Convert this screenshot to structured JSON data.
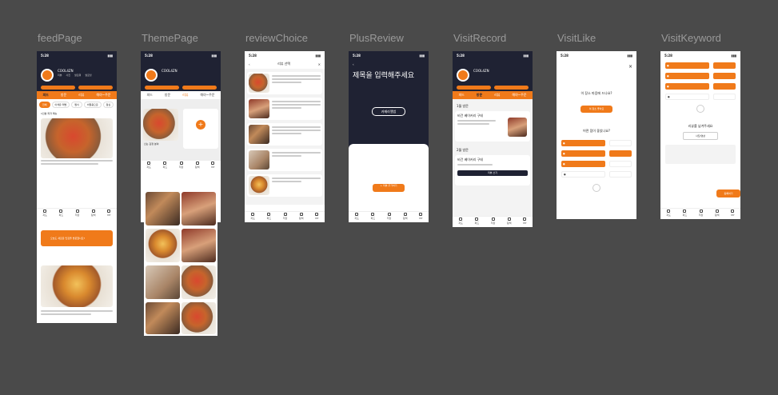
{
  "screens": [
    {
      "label": "feedPage"
    },
    {
      "label": "ThemePage"
    },
    {
      "label": "reviewChoice"
    },
    {
      "label": "PlusReview"
    },
    {
      "label": "VisitRecord"
    },
    {
      "label": "VisitLike"
    },
    {
      "label": "VisitKeyword"
    }
  ],
  "status": {
    "time": "5:28"
  },
  "profile": {
    "name": "COOL4ZN"
  },
  "tabs": [
    "피드",
    "방문",
    "리뷰",
    "해야~주문"
  ],
  "feed_chips": [
    "전체",
    "이색유 레벨",
    "찜식",
    "비밀용으로",
    "점심",
    "카페",
    "덧기"
  ],
  "feed_card": {
    "title": "1인분 피자 메뉴"
  },
  "feed_banner": {
    "text": "오늘도 새로운 맛집을 방문했나요?"
  },
  "theme": {
    "card_title": "신는 감정 분야"
  },
  "review_choice": {
    "title": "리뷰 선택"
  },
  "plus_review": {
    "title": "제목을 입력해주세요",
    "upload_label": "카메라앨범",
    "add_label": "+ 리뷰 추가하기"
  },
  "visit_record": {
    "month1": "1월 방문",
    "month2": "2월 방문",
    "place1": "비건 베이커리 구테",
    "place2": "비건 베이커리 구테",
    "write_btn": "리뷰 쓰기"
  },
  "visit_like": {
    "question": "이 장소 마음에 드나요?",
    "prompt": "어떤 점이 좋았나요?",
    "btn": "이 장소 좋아요"
  },
  "visit_keyword": {
    "prompt": "리뷰를 남겨주세요",
    "placeholder": "사진/영상",
    "submit": "등록하기"
  },
  "colors": {
    "accent": "#f07a1a",
    "dark": "#1f2233",
    "canvas": "#4a4a4a"
  }
}
